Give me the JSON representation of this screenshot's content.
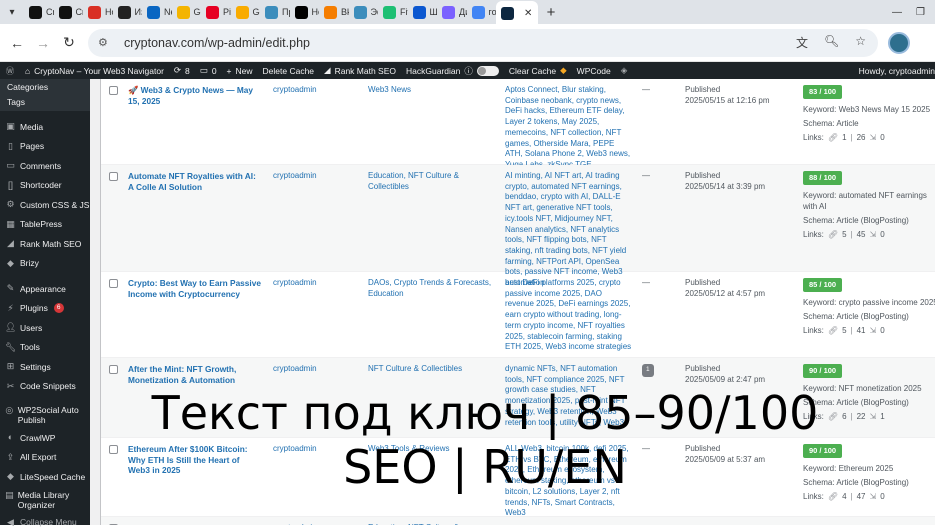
{
  "browser": {
    "tabs": [
      {
        "label": "Cre",
        "icon": "chatgpt-icon",
        "color": "#111111"
      },
      {
        "label": "Cre",
        "icon": "chatgpt-icon",
        "color": "#111111"
      },
      {
        "label": "Но",
        "icon": "gmail-icon",
        "color": "#d93025"
      },
      {
        "label": "Из",
        "icon": "k-icon",
        "color": "#222222"
      },
      {
        "label": "Ne",
        "icon": "linkedin-icon",
        "color": "#0a66c2"
      },
      {
        "label": "Go",
        "icon": "google-drive-icon",
        "color": "#f4b400"
      },
      {
        "label": "Pin",
        "icon": "pinterest-icon",
        "color": "#e60023"
      },
      {
        "label": "Go",
        "icon": "google-docs-icon",
        "color": "#f9ab00"
      },
      {
        "label": "Пр",
        "icon": "wp-tab-icon",
        "color": "#3c8dbc"
      },
      {
        "label": "Но",
        "icon": "x-icon",
        "color": "#000000"
      },
      {
        "label": "Вk",
        "icon": "blogger-icon",
        "color": "#f57d00"
      },
      {
        "label": "Эф",
        "icon": "wp-tab-icon",
        "color": "#3c8dbc"
      },
      {
        "label": "Fiv",
        "icon": "fiverr-icon",
        "color": "#1dbf73"
      },
      {
        "label": "Ш",
        "icon": "c-icon",
        "color": "#0b57d0"
      },
      {
        "label": "Ди",
        "icon": "copilot-icon",
        "color": "#7b61ff"
      },
      {
        "label": "гор",
        "icon": "google-icon",
        "color": "#4285f4"
      },
      {
        "label": "",
        "icon": "cryptonav-icon",
        "color": "#0d2740",
        "active": true
      }
    ],
    "url": "cryptonav.com/wp-admin/edit.php"
  },
  "adminbar": {
    "site": "CryptoNav – Your Web3 Navigator",
    "updates": "8",
    "comments": "0",
    "new": "New",
    "delete_cache": "Delete Cache",
    "rank_math": "Rank Math SEO",
    "hackguardian": "HackGuardian",
    "clear_cache": "Clear Cache",
    "wpcode": "WPCode",
    "howdy": "Howdy, cryptoadmin"
  },
  "sidebar": {
    "sub_categories": "Categories",
    "sub_tags": "Tags",
    "media": "Media",
    "pages": "Pages",
    "comments": "Comments",
    "shortcoder": "Shortcoder",
    "custom_css": "Custom CSS & JS",
    "tablepress": "TablePress",
    "rank_math": "Rank Math SEO",
    "brizy": "Brizy",
    "appearance": "Appearance",
    "plugins": "Plugins",
    "plugins_badge": "6",
    "users": "Users",
    "tools": "Tools",
    "settings": "Settings",
    "code_snippets": "Code Snippets",
    "wp2social": "WP2Social Auto Publish",
    "crawlwp": "CrawlWP",
    "all_export": "All Export",
    "litespeed": "LiteSpeed Cache",
    "media_library": "Media Library Organizer",
    "collapse": "Collapse Menu"
  },
  "posts": [
    {
      "title": "🚀 Web3 & Crypto News — May 15, 2025",
      "author": "cryptoadmin",
      "categories": "Web3 News",
      "tags": "Aptos Connect, Blur staking, Coinbase neobank, crypto news, DeFi hacks, Ethereum ETF delay, Layer 2 tokens, May 2025, memecoins, NFT collection, NFT games, Otherside Mara, PEPE ATH, Solana Phone 2, Web3 news, Yuga Labs, zkSync TGE",
      "comments": "—",
      "status": "Published",
      "date": "2025/05/15 at 12:16 pm",
      "score": "83 / 100",
      "keyword": "Keyword: Web3 News May 15 2025",
      "schema": "Schema: Article",
      "links_label": "Links:",
      "internal": "1",
      "external": "26",
      "incoming": "0"
    },
    {
      "title": "Automate NFT Royalties with AI: A Colle AI Solution",
      "author": "cryptoadmin",
      "categories": "Education, NFT Culture & Collectibles",
      "tags": "AI minting, AI NFT art, AI trading crypto, automated NFT earnings, benddao, crypto with AI, DALL-E NFT art, generative NFT tools, icy.tools NFT, Midjourney NFT, Nansen analytics, NFT analytics tools, NFT flipping bots, NFT staking, nft trading bots, NFT yield farming, NFTPort API, OpenSea bots, passive NFT income, Web3 automation",
      "comments": "—",
      "status": "Published",
      "date": "2025/05/14 at 3:39 pm",
      "score": "88 / 100",
      "keyword": "Keyword: automated NFT earnings with AI",
      "schema": "Schema: Article (BlogPosting)",
      "links_label": "Links:",
      "internal": "5",
      "external": "45",
      "incoming": "0"
    },
    {
      "title": "Crypto: Best Way to Earn Passive Income with Cryptocurrency",
      "author": "cryptoadmin",
      "categories": "DAOs, Crypto Trends & Forecasts, Education",
      "tags": "best DeFi platforms 2025, crypto passive income 2025, DAO revenue 2025, DeFi earnings 2025, earn crypto without trading, long-term crypto income, NFT royalties 2025, stablecoin farming, staking ETH 2025, Web3 income strategies",
      "comments": "—",
      "status": "Published",
      "date": "2025/05/12 at 4:57 pm",
      "score": "85 / 100",
      "keyword": "Keyword: crypto passive income 2025",
      "schema": "Schema: Article (BlogPosting)",
      "links_label": "Links:",
      "internal": "5",
      "external": "41",
      "incoming": "0"
    },
    {
      "title": "After the Mint: NFT Growth, Monetization & Automation",
      "author": "cryptoadmin",
      "categories": "NFT Culture & Collectibles",
      "tags": "dynamic NFTs, NFT automation tools, NFT compliance 2025, NFT growth case studies, NFT monetization 2025, post-mint NFT strategy, Web3 retention, Web3 retention tools, utility NFTs, Web3",
      "comments": "1",
      "status": "Published",
      "date": "2025/05/09 at 2:47 pm",
      "score": "90 / 100",
      "keyword": "Keyword: NFT monetization 2025",
      "schema": "Schema: Article (BlogPosting)",
      "links_label": "Links:",
      "internal": "6",
      "external": "22",
      "incoming": "1"
    },
    {
      "title": "Ethereum After $100K Bitcoin: Why ETH Is Still the Heart of Web3 in 2025",
      "author": "cryptoadmin",
      "categories": "Web3 Tools & Reviews",
      "tags": "ALL Web3, bitcoin 100k, defi 2025, ETH vs BTC, Ethereum, ethereum 2025, Ethereum ecosystem, ethereum staking, ethereum vs bitcoin, L2 solutions, Layer 2, nft trends, NFTs, Smart Contracts, Web3",
      "comments": "—",
      "status": "Published",
      "date": "2025/05/09 at 5:37 am",
      "score": "90 / 100",
      "keyword": "Keyword: Ethereum 2025",
      "schema": "Schema: Article (BlogPosting)",
      "links_label": "Links:",
      "internal": "4",
      "external": "47",
      "incoming": "0"
    },
    {
      "title": "NFT Trends 2025: Exploring",
      "author": "cryptoadmin",
      "categories": "Education, NFT Culture & Collectibles",
      "tags": "",
      "comments": "",
      "status": "",
      "date": "",
      "score": "",
      "keyword": "",
      "schema": "",
      "links_label": "",
      "internal": "",
      "external": "",
      "incoming": ""
    }
  ],
  "overlay": {
    "line1": "Текст под ключ | 85–90/100",
    "line2": "SEO | RU/EN"
  }
}
